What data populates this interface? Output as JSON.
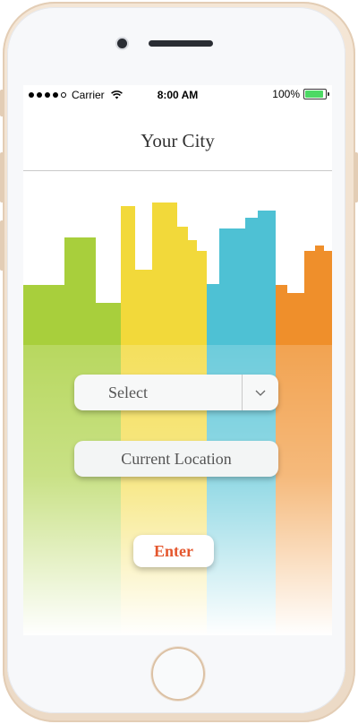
{
  "status_bar": {
    "carrier": "Carrier",
    "time": "8:00 AM",
    "battery": "100%",
    "signal_icon": "signal-dots-icon",
    "wifi_icon": "wifi-icon",
    "battery_icon": "battery-icon"
  },
  "header": {
    "title": "Your City"
  },
  "city_select": {
    "selected": "Select",
    "dropdown_icon": "chevron-down-icon"
  },
  "current_location": {
    "label": "Current Location"
  },
  "enter_button": {
    "label": "Enter"
  },
  "colors": {
    "green": "#a8cf3c",
    "yellow": "#f2d93a",
    "blue": "#4ec1d4",
    "orange": "#ef8f2b",
    "accent": "#e4572e"
  }
}
